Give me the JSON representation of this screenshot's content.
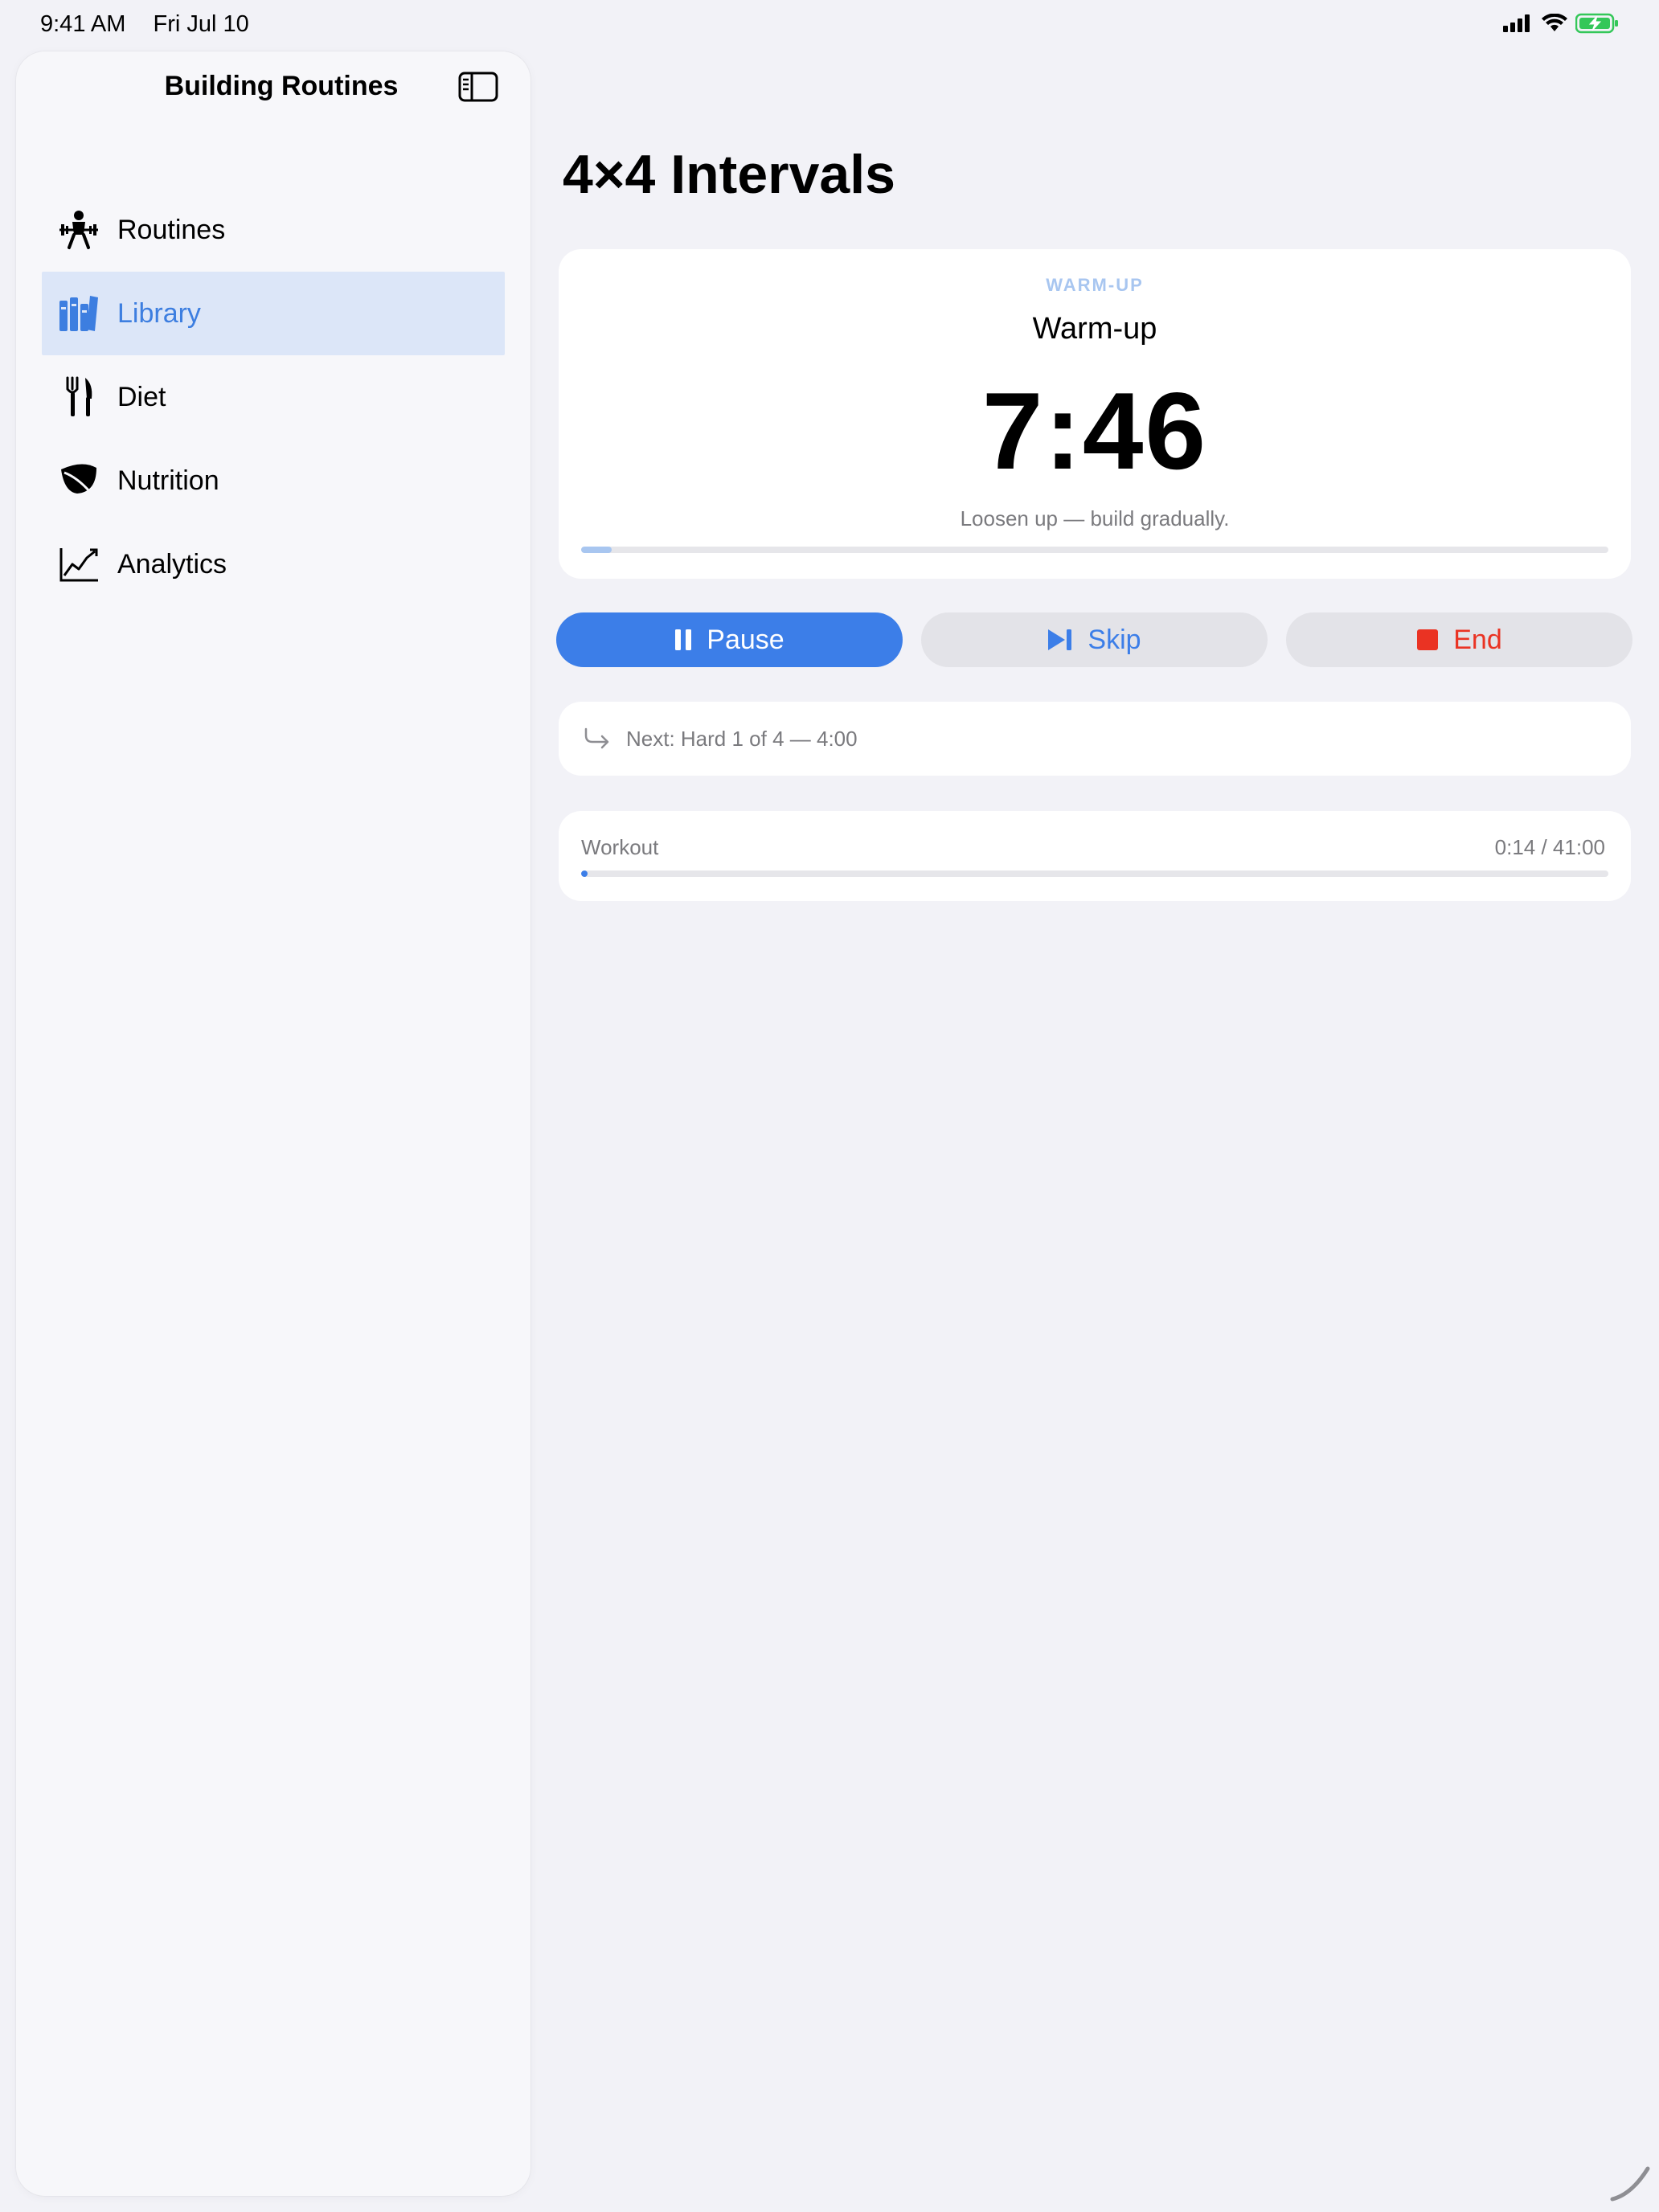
{
  "status_bar": {
    "time": "9:41 AM",
    "date": "Fri Jul 10",
    "battery_color": "#34c759"
  },
  "sidebar": {
    "title": "Building Routines",
    "toggle_icon": "sidebar-toggle-icon",
    "items": [
      {
        "label": "Routines",
        "icon": "weightlifter-icon",
        "selected": false
      },
      {
        "label": "Library",
        "icon": "books-icon",
        "selected": true
      },
      {
        "label": "Diet",
        "icon": "fork-knife-icon",
        "selected": false
      },
      {
        "label": "Nutrition",
        "icon": "leaf-icon",
        "selected": false
      },
      {
        "label": "Analytics",
        "icon": "chart-line-icon",
        "selected": false
      }
    ]
  },
  "main": {
    "title": "4×4 Intervals",
    "phase": {
      "caption": "WARM-UP",
      "name": "Warm-up",
      "remaining": "7:46",
      "hint": "Loosen up — build gradually.",
      "progress_fraction": 0.03
    },
    "controls": {
      "pause_label": "Pause",
      "skip_label": "Skip",
      "end_label": "End"
    },
    "next": {
      "text": "Next: Hard 1 of 4 — 4:00"
    },
    "workout": {
      "label": "Workout",
      "time": "0:14 / 41:00",
      "progress_fraction": 0.006
    }
  },
  "colors": {
    "accent": "#3c7ee8",
    "destructive": "#ea3323",
    "selected_bg": "#dce6f8"
  }
}
